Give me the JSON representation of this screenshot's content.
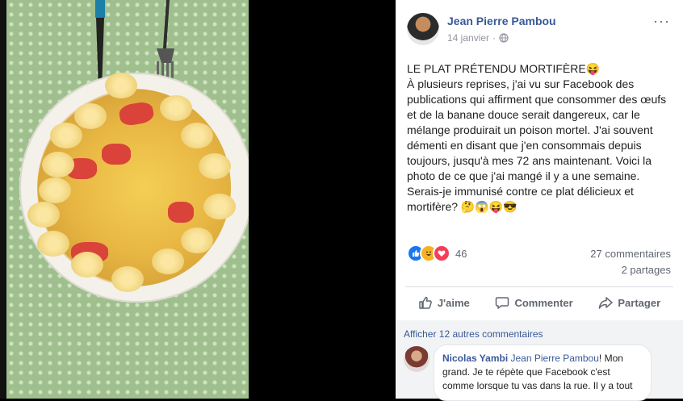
{
  "post": {
    "author": "Jean Pierre Pambou",
    "date": "14 janvier",
    "more_label": "···",
    "text_title": "LE PLAT PRÉTENDU MORTIFÈRE😝",
    "text_body": "À plusieurs reprises, j'ai vu sur Facebook des publications qui affirment que consommer des œufs et de la banane douce serait dangereux, car le mélange produirait un poison mortel. J'ai souvent démenti en disant que j'en consommais depuis toujours, jusqu'à mes 72 ans maintenant. Voici la photo de ce que j'ai mangé il y a une semaine. Serais-je immunisé contre ce plat délicieux et mortifère? 🤔😱😝😎"
  },
  "reactions": {
    "count": "46",
    "icons": [
      "like-icon",
      "haha-icon",
      "love-icon"
    ],
    "comments_count": "27 commentaires",
    "shares_count": "2 partages"
  },
  "actions": {
    "like": "J'aime",
    "comment": "Commenter",
    "share": "Partager"
  },
  "comments": {
    "more_label": "Afficher 12 autres commentaires",
    "first": {
      "author": "Nicolas Yambi",
      "tag": "Jean Pierre Pambou",
      "text": "! Mon grand. Je te répète que Facebook c'est comme lorsque tu vas dans la rue. Il y a tout"
    }
  },
  "colors": {
    "link_blue": "#385898",
    "meta_gray": "#90949c",
    "like_blue": "#1877f2",
    "love_red": "#f33e58",
    "haha_yellow": "#f7b125"
  }
}
